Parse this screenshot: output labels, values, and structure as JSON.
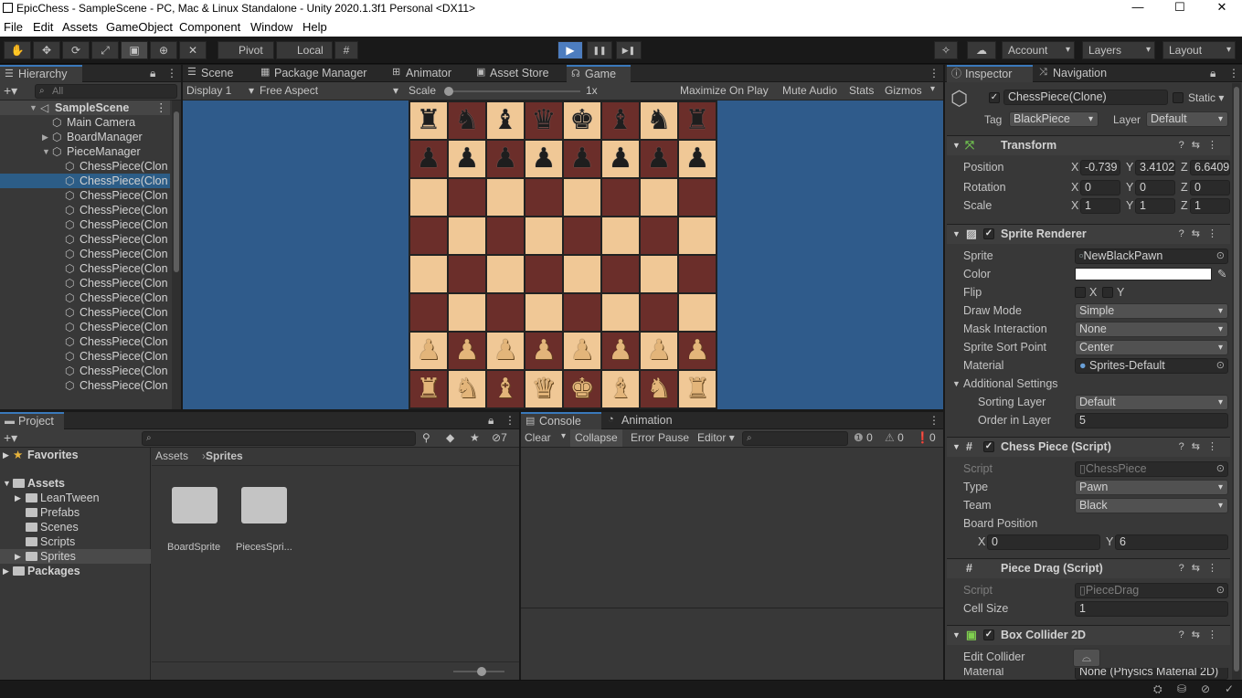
{
  "window": {
    "title": "EpicChess - SampleScene - PC, Mac & Linux Standalone - Unity 2020.1.3f1 Personal <DX11>",
    "minimize": "—",
    "maximize": "☐",
    "close": "✕"
  },
  "menu": [
    "File",
    "Edit",
    "Assets",
    "GameObject",
    "Component",
    "Window",
    "Help"
  ],
  "toolbar": {
    "pivot": "Pivot",
    "local": "Local",
    "account": "Account",
    "layers": "Layers",
    "layout": "Layout",
    "play_icon": "▶",
    "pause_icon": "❚❚",
    "step_icon": "▶❚"
  },
  "hierarchy": {
    "tab": "Hierarchy",
    "search_placeholder": "All",
    "scene": "SampleScene",
    "items": [
      {
        "label": "Main Camera"
      },
      {
        "label": "BoardManager"
      },
      {
        "label": "PieceManager"
      },
      {
        "label": "ChessPiece(Clon"
      },
      {
        "label": "ChessPiece(Clon"
      },
      {
        "label": "ChessPiece(Clon"
      },
      {
        "label": "ChessPiece(Clon"
      },
      {
        "label": "ChessPiece(Clon"
      },
      {
        "label": "ChessPiece(Clon"
      },
      {
        "label": "ChessPiece(Clon"
      },
      {
        "label": "ChessPiece(Clon"
      },
      {
        "label": "ChessPiece(Clon"
      },
      {
        "label": "ChessPiece(Clon"
      },
      {
        "label": "ChessPiece(Clon"
      },
      {
        "label": "ChessPiece(Clon"
      },
      {
        "label": "ChessPiece(Clon"
      },
      {
        "label": "ChessPiece(Clon"
      },
      {
        "label": "ChessPiece(Clon"
      },
      {
        "label": "ChessPiece(Clon"
      }
    ]
  },
  "center_tabs": [
    "Scene",
    "Package Manager",
    "Animator",
    "Asset Store",
    "Game"
  ],
  "game": {
    "display": "Display 1",
    "aspect": "Free Aspect",
    "scale_label": "Scale",
    "scale_value": "1x",
    "maximize": "Maximize On Play",
    "mute": "Mute Audio",
    "stats": "Stats",
    "gizmos": "Gizmos",
    "board_rows": [
      [
        "♜",
        "♞",
        "♝",
        "♛",
        "♚",
        "♝",
        "♞",
        "♜"
      ],
      [
        "♟",
        "♟",
        "♟",
        "♟",
        "♟",
        "♟",
        "♟",
        "♟"
      ],
      [
        "",
        "",
        "",
        "",
        "",
        "",
        "",
        ""
      ],
      [
        "",
        "",
        "",
        "",
        "",
        "",
        "",
        ""
      ],
      [
        "",
        "",
        "",
        "",
        "",
        "",
        "",
        ""
      ],
      [
        "",
        "",
        "",
        "",
        "",
        "",
        "",
        ""
      ],
      [
        "♟",
        "♟",
        "♟",
        "♟",
        "♟",
        "♟",
        "♟",
        "♟"
      ],
      [
        "♜",
        "♞",
        "♝",
        "♛",
        "♚",
        "♝",
        "♞",
        "♜"
      ]
    ]
  },
  "project": {
    "tab": "Project",
    "hidden_count": "7",
    "favorites": "Favorites",
    "assets": "Assets",
    "folders": [
      "LeanTween",
      "Prefabs",
      "Scenes",
      "Scripts",
      "Sprites"
    ],
    "packages": "Packages",
    "breadcrumb_root": "Assets",
    "breadcrumb_current": "Sprites",
    "grid_items": [
      "BoardSprite",
      "PiecesSpri..."
    ]
  },
  "console": {
    "tabs": [
      "Console",
      "Animation"
    ],
    "clear": "Clear",
    "collapse": "Collapse",
    "error_pause": "Error Pause",
    "editor": "Editor",
    "counts": [
      "0",
      "0",
      "0"
    ]
  },
  "inspector": {
    "tabs": [
      "Inspector",
      "Navigation"
    ],
    "object_name": "ChessPiece(Clone)",
    "static": "Static",
    "tag_label": "Tag",
    "tag": "BlackPiece",
    "layer_label": "Layer",
    "layer": "Default",
    "transform": {
      "title": "Transform",
      "position_label": "Position",
      "rotation_label": "Rotation",
      "scale_label": "Scale",
      "position": [
        "-0.739",
        "3.4102",
        "6.6409"
      ],
      "rotation": [
        "0",
        "0",
        "0"
      ],
      "scale": [
        "1",
        "1",
        "1"
      ]
    },
    "sprite_renderer": {
      "title": "Sprite Renderer",
      "sprite_label": "Sprite",
      "sprite": "NewBlackPawn",
      "color_label": "Color",
      "flip_label": "Flip",
      "draw_mode_label": "Draw Mode",
      "draw_mode": "Simple",
      "mask_label": "Mask Interaction",
      "mask": "None",
      "sort_point_label": "Sprite Sort Point",
      "sort_point": "Center",
      "material_label": "Material",
      "material": "Sprites-Default",
      "additional": "Additional Settings",
      "sorting_layer_label": "Sorting Layer",
      "sorting_layer": "Default",
      "order_label": "Order in Layer",
      "order": "5"
    },
    "chess_piece": {
      "title": "Chess Piece (Script)",
      "script_label": "Script",
      "script": "ChessPiece",
      "type_label": "Type",
      "type": "Pawn",
      "team_label": "Team",
      "team": "Black",
      "board_pos_label": "Board Position",
      "board_x": "0",
      "board_y": "6"
    },
    "piece_drag": {
      "title": "Piece Drag (Script)",
      "script_label": "Script",
      "script": "PieceDrag",
      "cell_size_label": "Cell Size",
      "cell_size": "1"
    },
    "box_collider": {
      "title": "Box Collider 2D",
      "edit_label": "Edit Collider",
      "material_label": "Material",
      "material": "None (Physics Material 2D)"
    }
  }
}
